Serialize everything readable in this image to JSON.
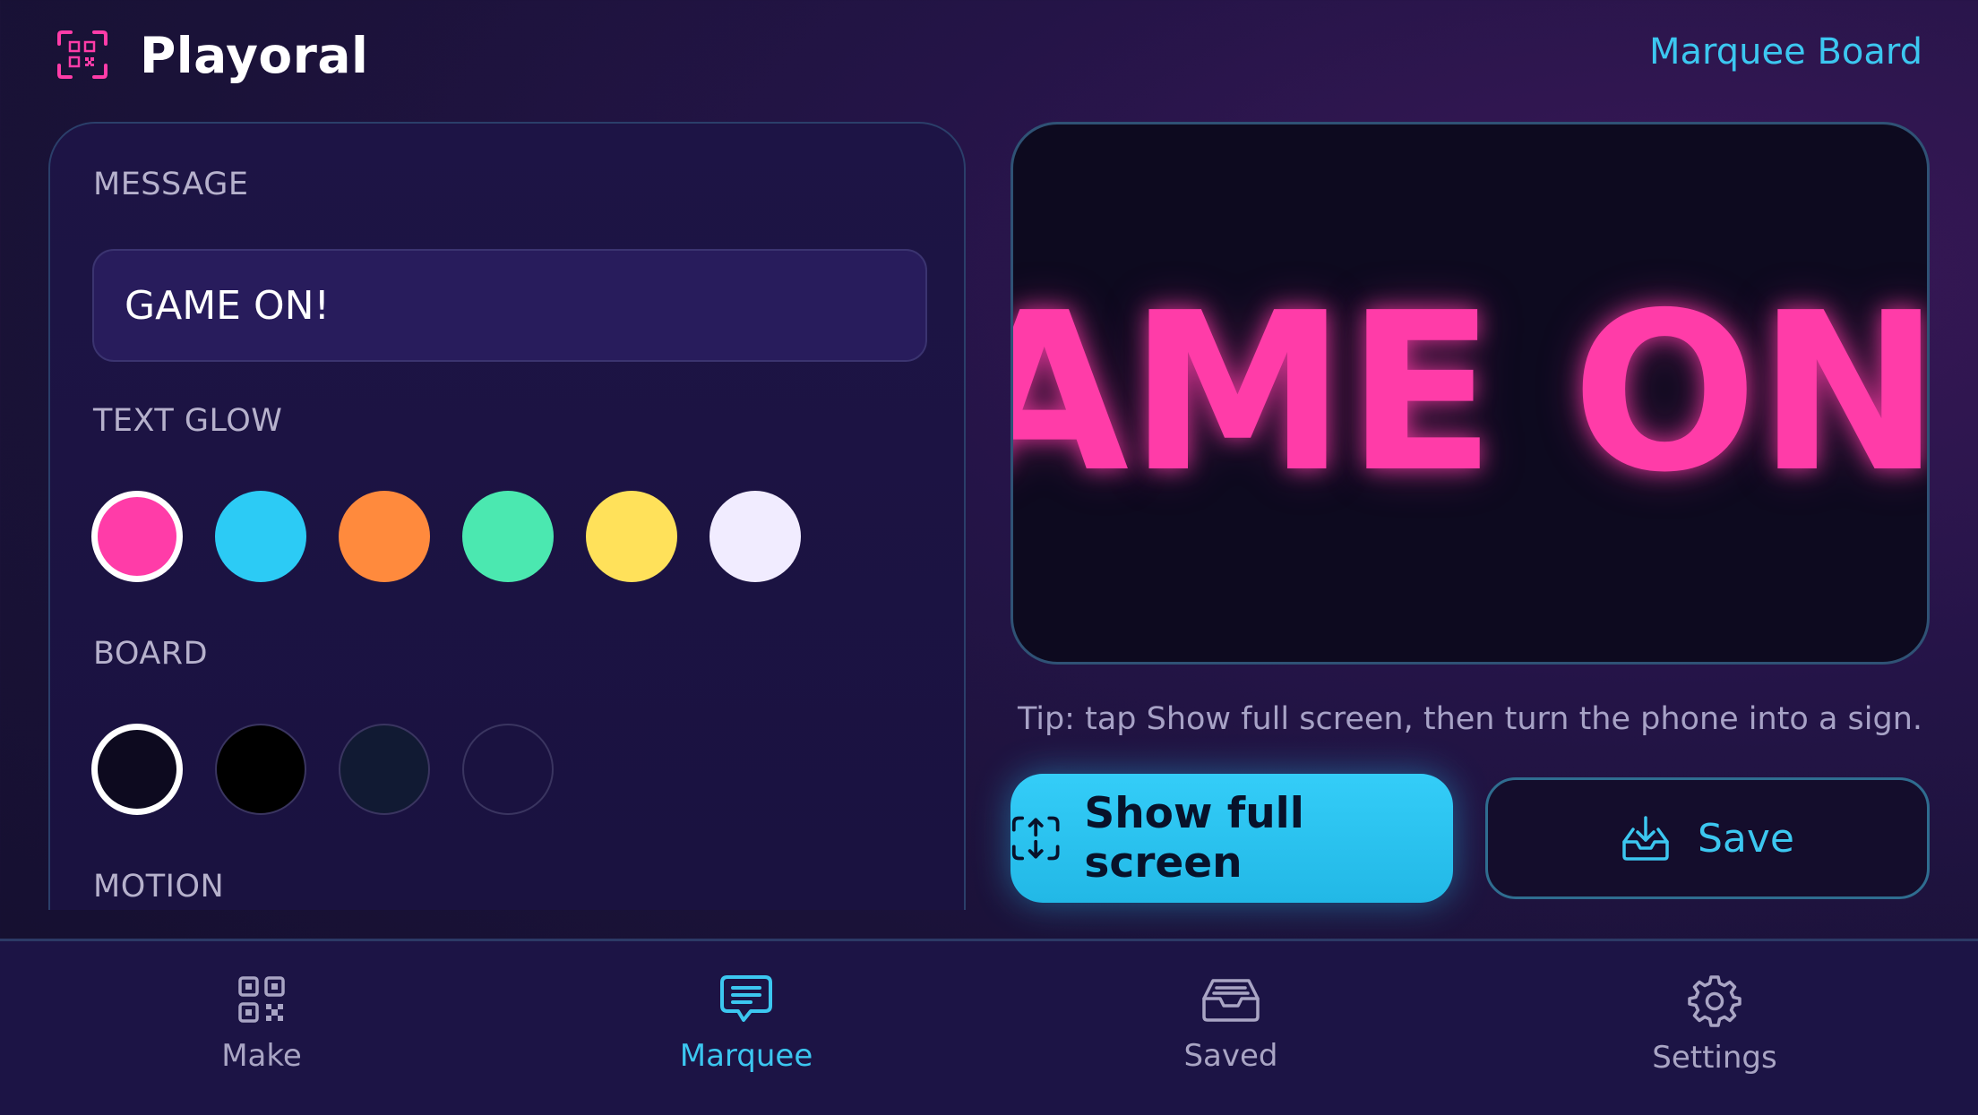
{
  "app": {
    "name": "Playoral",
    "header_link": "Marquee Board"
  },
  "editor": {
    "message_label": "MESSAGE",
    "message_value": "GAME ON!",
    "text_glow_label": "TEXT GLOW",
    "text_glow_colors": [
      "#ff3ca8",
      "#2ccbf5",
      "#ff8a3d",
      "#4be8b0",
      "#ffe15a",
      "#f1ecff"
    ],
    "text_glow_selected": 0,
    "board_label": "BOARD",
    "board_colors": [
      "#0d0a1f",
      "#000000",
      "#111a33",
      "#1a1240"
    ],
    "board_selected": 0,
    "motion_label": "MOTION"
  },
  "preview": {
    "text": "GAME ON!"
  },
  "tip": "Tip: tap Show full screen, then turn the phone into a sign.",
  "actions": {
    "fullscreen_label": "Show full screen",
    "save_label": "Save"
  },
  "nav": {
    "items": [
      {
        "label": "Make",
        "icon": "qr-code-icon"
      },
      {
        "label": "Marquee",
        "icon": "chat-bubble-icon",
        "active": true
      },
      {
        "label": "Saved",
        "icon": "inbox-tray-icon"
      },
      {
        "label": "Settings",
        "icon": "gear-icon"
      }
    ]
  },
  "colors": {
    "accent": "#3cc7f0",
    "glow": "#ff3ca8",
    "background": "#1a1238"
  }
}
